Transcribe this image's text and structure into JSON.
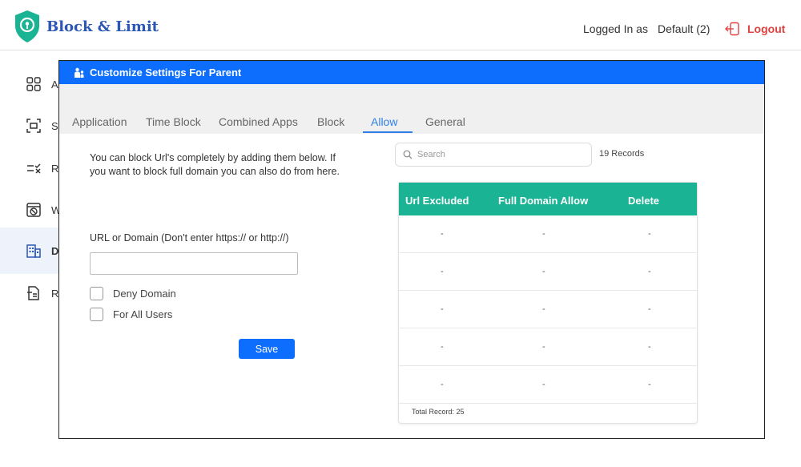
{
  "app": {
    "brand": "Block & Limit",
    "logged_in_label": "Logged In as",
    "user": "Default (2)",
    "logout_label": "Logout"
  },
  "sidebar": {
    "items": [
      {
        "label": "A",
        "icon": "apps-grid-icon"
      },
      {
        "label": "S",
        "icon": "scan-icon"
      },
      {
        "label": "R",
        "icon": "checklist-icon"
      },
      {
        "label": "W",
        "icon": "web-block-icon"
      },
      {
        "label": "D",
        "icon": "building-icon",
        "active": true
      },
      {
        "label": "R",
        "icon": "report-icon"
      }
    ]
  },
  "modal": {
    "title": "Customize Settings For Parent",
    "tabs": [
      {
        "label": "Application"
      },
      {
        "label": "Time Block"
      },
      {
        "label": "Combined Apps"
      },
      {
        "label": "Block"
      },
      {
        "label": "Allow",
        "active": true
      },
      {
        "label": "General"
      }
    ],
    "intro": "You can block Url's completely by adding them below. If you want to block full domain you can also do from here.",
    "url_label": "URL or Domain (Don't enter https:// or http://)",
    "url_value": "",
    "deny_domain_label": "Deny Domain",
    "for_all_users_label": "For All Users",
    "save_label": "Save",
    "search_placeholder": "Search",
    "records_label": "19 Records",
    "table": {
      "headers": [
        "Url Excluded",
        "Full Domain Allow",
        "Delete"
      ],
      "rows": [
        [
          "-",
          "-",
          "-"
        ],
        [
          "-",
          "-",
          "-"
        ],
        [
          "-",
          "-",
          "-"
        ],
        [
          "-",
          "-",
          "-"
        ],
        [
          "-",
          "-",
          "-"
        ]
      ],
      "footer": "Total Record: 25"
    }
  },
  "colors": {
    "brand": "#2a56b5",
    "primary": "#0d6efd",
    "table_header": "#1ab394",
    "logout": "#e0413e",
    "active_tab": "#2f7fe6"
  }
}
